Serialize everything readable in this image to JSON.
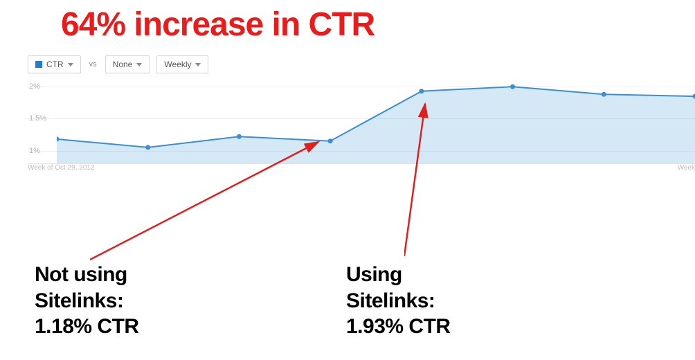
{
  "headline": "64% increase in CTR",
  "controls": {
    "metric_label": "CTR",
    "vs_label": "vs",
    "compare_label": "None",
    "granularity_label": "Weekly"
  },
  "xaxis": {
    "left_label": "Week of Oct 29, 2012",
    "right_label": "Week"
  },
  "yaxis": {
    "ticks": [
      "1%",
      "1.5%",
      "2%"
    ]
  },
  "annotations": {
    "left": "Not using\nSitelinks:\n1.18% CTR",
    "right": "Using\nSitelinks:\n1.93% CTR"
  },
  "colors": {
    "headline": "#ec1b1b",
    "line": "#3b8ed3",
    "area": "rgba(88,162,214,0.25)",
    "arrow": "#e11f1f"
  },
  "chart_data": {
    "type": "line",
    "title": "64% increase in CTR",
    "xlabel": "Week",
    "ylabel": "CTR",
    "ylim": [
      0.8,
      2.1
    ],
    "x": [
      0,
      1,
      2,
      3,
      4,
      5,
      6,
      7
    ],
    "categories_known": {
      "0": "Week of Oct 29, 2012"
    },
    "values": [
      1.18,
      1.05,
      1.22,
      1.15,
      1.93,
      2.0,
      1.88,
      1.85
    ],
    "series": [
      {
        "name": "CTR",
        "values": [
          1.18,
          1.05,
          1.22,
          1.15,
          1.93,
          2.0,
          1.88,
          1.85
        ]
      }
    ],
    "annotations": [
      {
        "at_index": 3,
        "label": "Not using Sitelinks: 1.18% CTR"
      },
      {
        "at_index": 4,
        "label": "Using Sitelinks: 1.93% CTR"
      }
    ]
  }
}
